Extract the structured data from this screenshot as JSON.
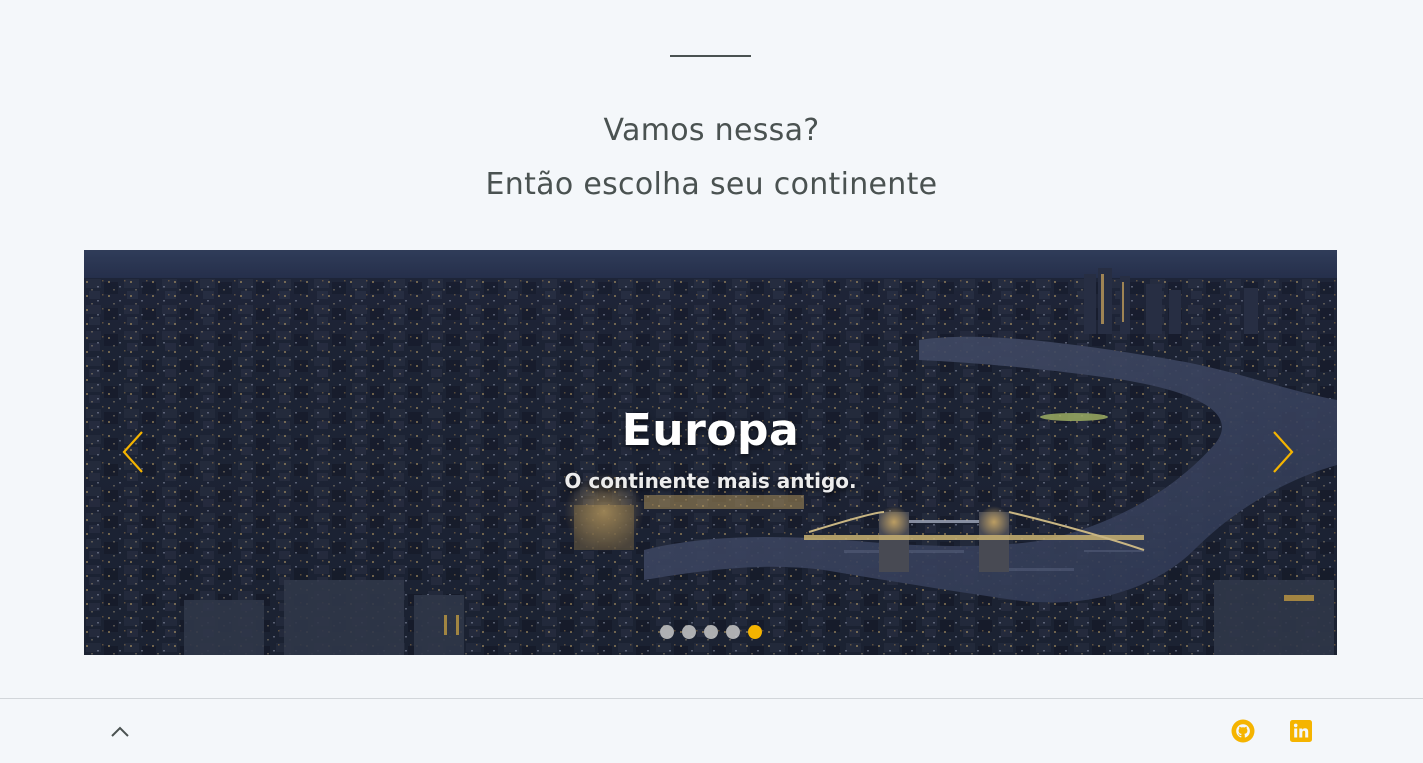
{
  "section": {
    "heading_line1": "Vamos nessa?",
    "heading_line2": "Então escolha seu continente"
  },
  "carousel": {
    "active_index": 4,
    "slide_count": 5,
    "slide": {
      "title": "Europa",
      "subtitle": "O continente mais antigo."
    },
    "arrow_color": "#f5b400",
    "indicator_active_color": "#f5b400",
    "icons": {
      "prev": "chevron-left-icon",
      "next": "chevron-right-icon"
    }
  },
  "footer": {
    "icons": {
      "back_to_top": "chevron-up-icon",
      "github": "github-icon",
      "linkedin": "linkedin-icon"
    },
    "accent_color": "#f5b400"
  }
}
